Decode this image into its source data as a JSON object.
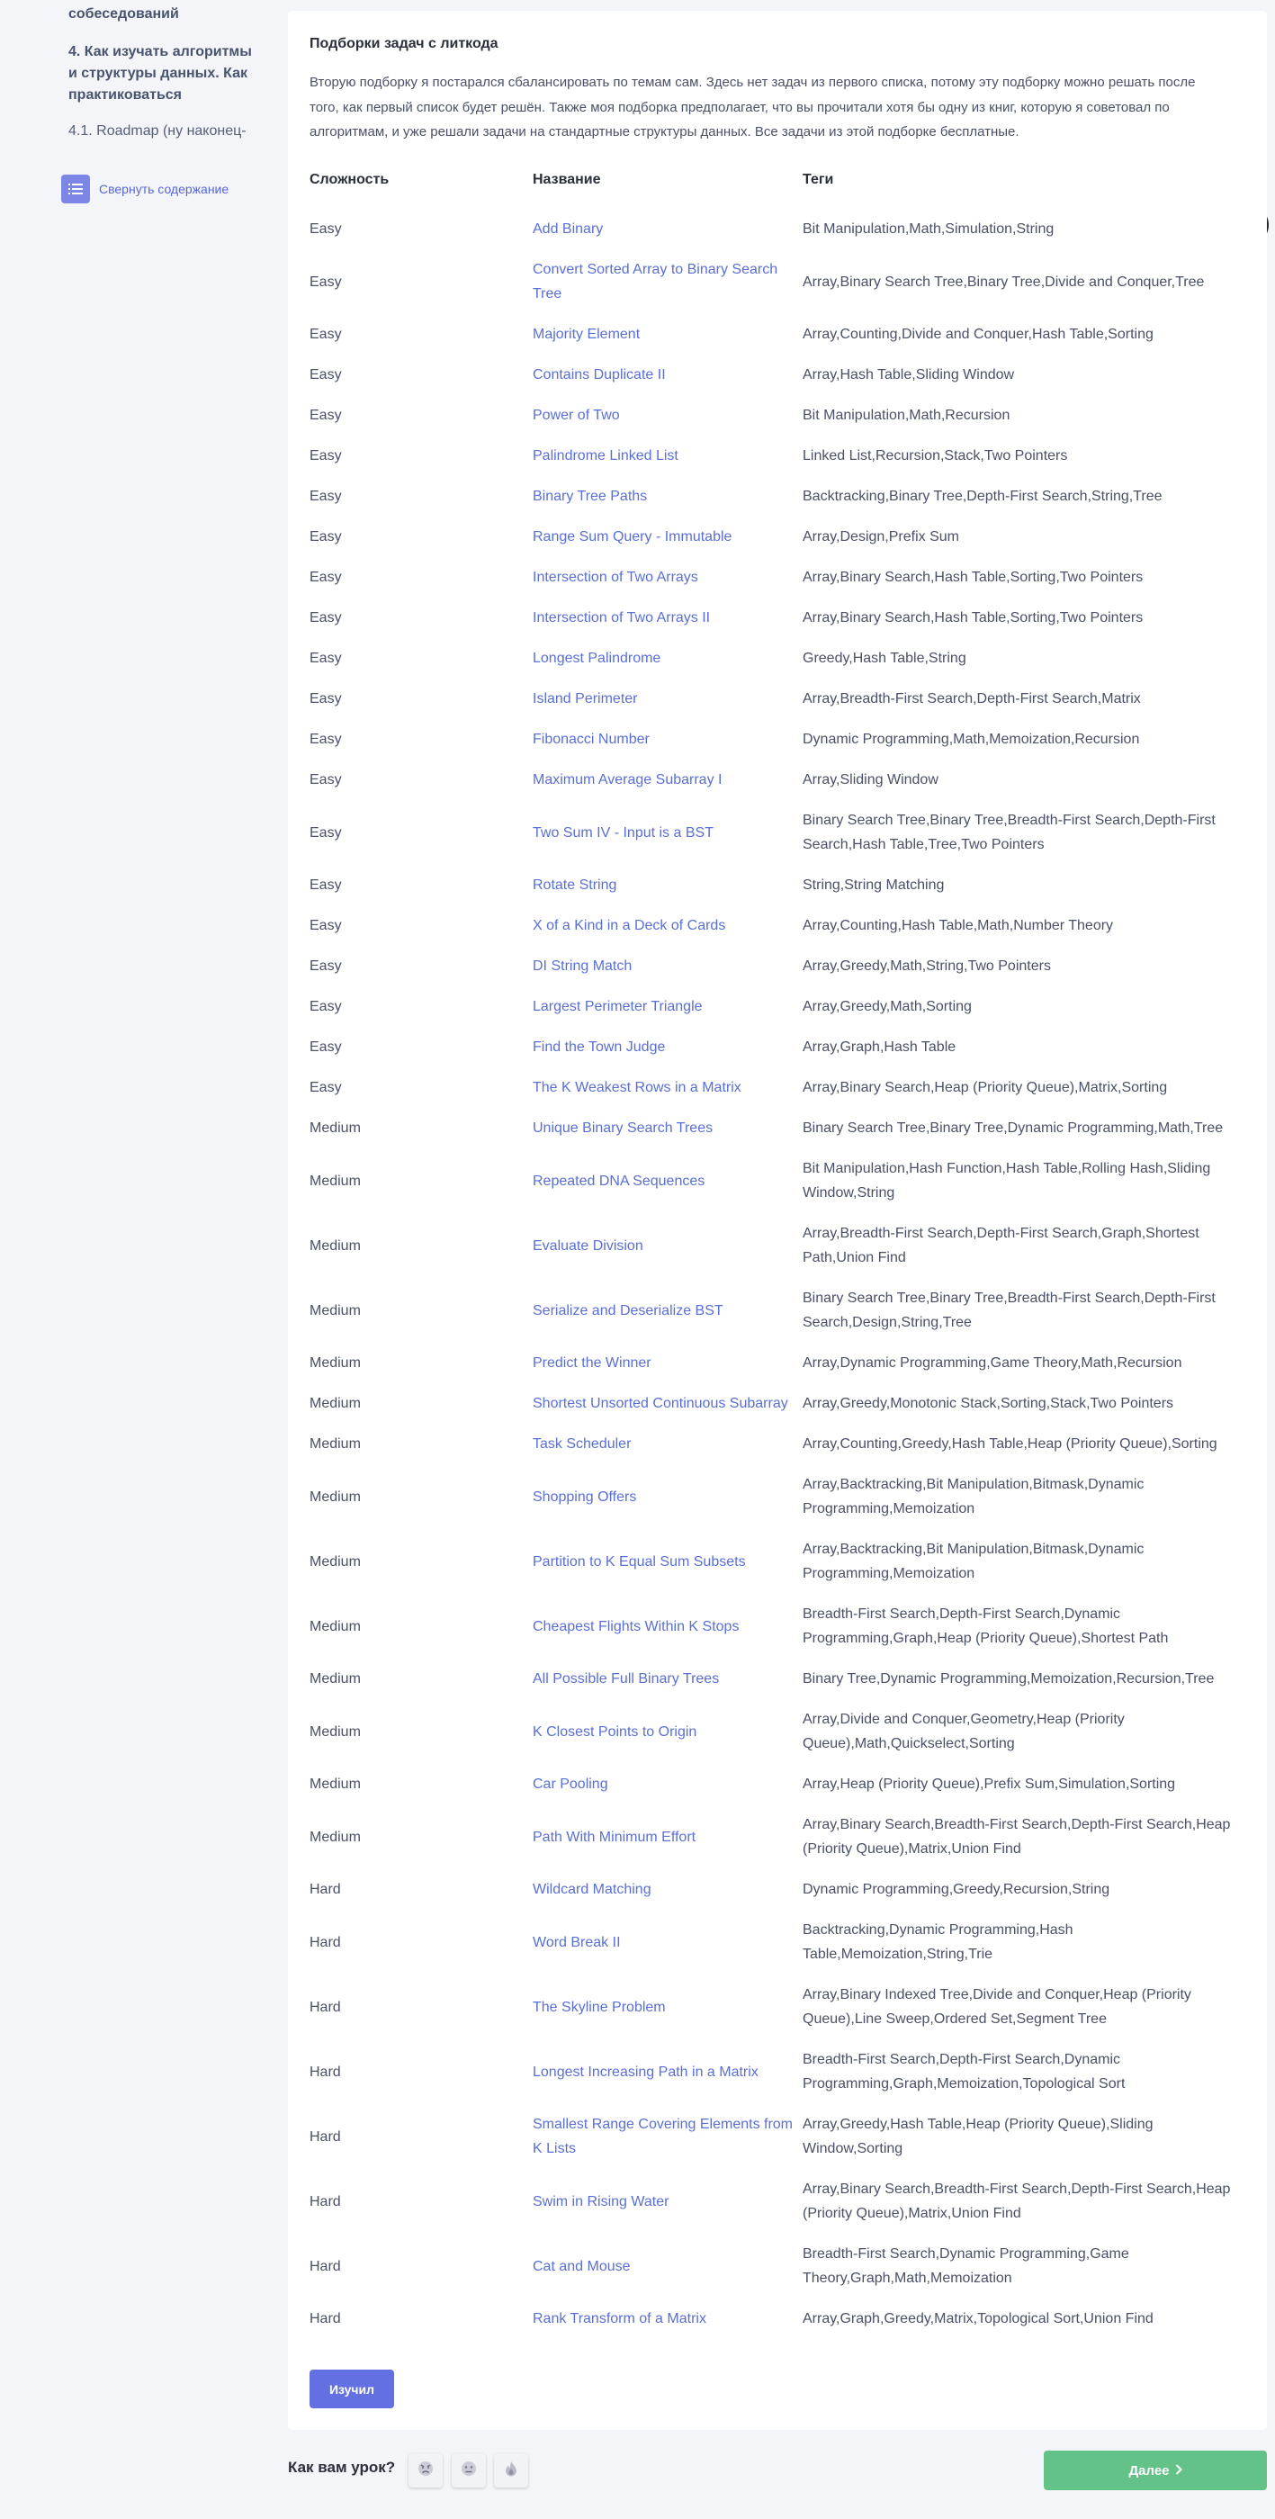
{
  "sidebar": {
    "items": [
      {
        "text": "собеседований",
        "kind": "bold"
      },
      {
        "text": "4. Как изучать алгоритмы и структуры данных. Как практиковаться",
        "kind": "bold"
      },
      {
        "text": "4.1. Roadmap (ну наконец-",
        "kind": "sub"
      }
    ],
    "collapse_label": "Свернуть содержание"
  },
  "section": {
    "title": "Подборки задач с литкода",
    "intro": "Вторую подборку я постарался сбалансировать по темам сам. Здесь нет задач из первого списка, потому эту подборку можно решать после того, как первый список будет решён. Также моя подборка предполагает, что вы прочитали хотя бы одну из книг, которую я советовал по алгоритмам, и уже решали задачи на стандартные структуры данных. Все задачи из этой подборке бесплатные.",
    "columns": [
      "Сложность",
      "Название",
      "Теги"
    ],
    "rows": [
      [
        "Easy",
        "Add Binary",
        "Bit Manipulation,Math,Simulation,String"
      ],
      [
        "Easy",
        "Convert Sorted Array to Binary Search Tree",
        "Array,Binary Search Tree,Binary Tree,Divide and Conquer,Tree"
      ],
      [
        "Easy",
        "Majority Element",
        "Array,Counting,Divide and Conquer,Hash Table,Sorting"
      ],
      [
        "Easy",
        "Contains Duplicate II",
        "Array,Hash Table,Sliding Window"
      ],
      [
        "Easy",
        "Power of Two",
        "Bit Manipulation,Math,Recursion"
      ],
      [
        "Easy",
        "Palindrome Linked List",
        "Linked List,Recursion,Stack,Two Pointers"
      ],
      [
        "Easy",
        "Binary Tree Paths",
        "Backtracking,Binary Tree,Depth-First Search,String,Tree"
      ],
      [
        "Easy",
        "Range Sum Query - Immutable",
        "Array,Design,Prefix Sum"
      ],
      [
        "Easy",
        "Intersection of Two Arrays",
        "Array,Binary Search,Hash Table,Sorting,Two Pointers"
      ],
      [
        "Easy",
        "Intersection of Two Arrays II",
        "Array,Binary Search,Hash Table,Sorting,Two Pointers"
      ],
      [
        "Easy",
        "Longest Palindrome",
        "Greedy,Hash Table,String"
      ],
      [
        "Easy",
        "Island Perimeter",
        "Array,Breadth-First Search,Depth-First Search,Matrix"
      ],
      [
        "Easy",
        "Fibonacci Number",
        "Dynamic Programming,Math,Memoization,Recursion"
      ],
      [
        "Easy",
        "Maximum Average Subarray I",
        "Array,Sliding Window"
      ],
      [
        "Easy",
        "Two Sum IV - Input is a BST",
        "Binary Search Tree,Binary Tree,Breadth-First Search,Depth-First Search,Hash Table,Tree,Two Pointers"
      ],
      [
        "Easy",
        "Rotate String",
        "String,String Matching"
      ],
      [
        "Easy",
        "X of a Kind in a Deck of Cards",
        "Array,Counting,Hash Table,Math,Number Theory"
      ],
      [
        "Easy",
        "DI String Match",
        "Array,Greedy,Math,String,Two Pointers"
      ],
      [
        "Easy",
        "Largest Perimeter Triangle",
        "Array,Greedy,Math,Sorting"
      ],
      [
        "Easy",
        "Find the Town Judge",
        "Array,Graph,Hash Table"
      ],
      [
        "Easy",
        "The K Weakest Rows in a Matrix",
        "Array,Binary Search,Heap (Priority Queue),Matrix,Sorting"
      ],
      [
        "Medium",
        "Unique Binary Search Trees",
        "Binary Search Tree,Binary Tree,Dynamic Programming,Math,Tree"
      ],
      [
        "Medium",
        "Repeated DNA Sequences",
        "Bit Manipulation,Hash Function,Hash Table,Rolling Hash,Sliding Window,String"
      ],
      [
        "Medium",
        "Evaluate Division",
        "Array,Breadth-First Search,Depth-First Search,Graph,Shortest Path,Union Find"
      ],
      [
        "Medium",
        "Serialize and Deserialize BST",
        "Binary Search Tree,Binary Tree,Breadth-First Search,Depth-First Search,Design,String,Tree"
      ],
      [
        "Medium",
        "Predict the Winner",
        "Array,Dynamic Programming,Game Theory,Math,Recursion"
      ],
      [
        "Medium",
        "Shortest Unsorted Continuous Subarray",
        "Array,Greedy,Monotonic Stack,Sorting,Stack,Two Pointers"
      ],
      [
        "Medium",
        "Task Scheduler",
        "Array,Counting,Greedy,Hash Table,Heap (Priority Queue),Sorting"
      ],
      [
        "Medium",
        "Shopping Offers",
        "Array,Backtracking,Bit Manipulation,Bitmask,Dynamic Programming,Memoization"
      ],
      [
        "Medium",
        "Partition to K Equal Sum Subsets",
        "Array,Backtracking,Bit Manipulation,Bitmask,Dynamic Programming,Memoization"
      ],
      [
        "Medium",
        "Cheapest Flights Within K Stops",
        "Breadth-First Search,Depth-First Search,Dynamic Programming,Graph,Heap (Priority Queue),Shortest Path"
      ],
      [
        "Medium",
        "All Possible Full Binary Trees",
        "Binary Tree,Dynamic Programming,Memoization,Recursion,Tree"
      ],
      [
        "Medium",
        "K Closest Points to Origin",
        "Array,Divide and Conquer,Geometry,Heap (Priority Queue),Math,Quickselect,Sorting"
      ],
      [
        "Medium",
        "Car Pooling",
        "Array,Heap (Priority Queue),Prefix Sum,Simulation,Sorting"
      ],
      [
        "Medium",
        "Path With Minimum Effort",
        "Array,Binary Search,Breadth-First Search,Depth-First Search,Heap (Priority Queue),Matrix,Union Find"
      ],
      [
        "Hard",
        "Wildcard Matching",
        "Dynamic Programming,Greedy,Recursion,String"
      ],
      [
        "Hard",
        "Word Break II",
        "Backtracking,Dynamic Programming,Hash Table,Memoization,String,Trie"
      ],
      [
        "Hard",
        "The Skyline Problem",
        "Array,Binary Indexed Tree,Divide and Conquer,Heap (Priority Queue),Line Sweep,Ordered Set,Segment Tree"
      ],
      [
        "Hard",
        "Longest Increasing Path in a Matrix",
        "Breadth-First Search,Depth-First Search,Dynamic Programming,Graph,Memoization,Topological Sort"
      ],
      [
        "Hard",
        "Smallest Range Covering Elements from K Lists",
        "Array,Greedy,Hash Table,Heap (Priority Queue),Sliding Window,Sorting"
      ],
      [
        "Hard",
        "Swim in Rising Water",
        "Array,Binary Search,Breadth-First Search,Depth-First Search,Heap (Priority Queue),Matrix,Union Find"
      ],
      [
        "Hard",
        "Cat and Mouse",
        "Breadth-First Search,Dynamic Programming,Game Theory,Graph,Math,Memoization"
      ],
      [
        "Hard",
        "Rank Transform of a Matrix",
        "Array,Graph,Greedy,Matrix,Topological Sort,Union Find"
      ]
    ],
    "learned_label": "Изучил"
  },
  "footer": {
    "rate_label": "Как вам урок?",
    "rate_icons": [
      "angry-face-icon",
      "neutral-face-icon",
      "fire-icon"
    ],
    "next_label": "Далее",
    "next_color": "#63c287"
  },
  "colors": {
    "accent": "#6370e1",
    "link": "#5a6fd6",
    "chat": "#1f232b"
  },
  "icons": {
    "collapse": "list-icon",
    "chat": "chat-bubble-icon",
    "next": "chevron-right-icon"
  }
}
